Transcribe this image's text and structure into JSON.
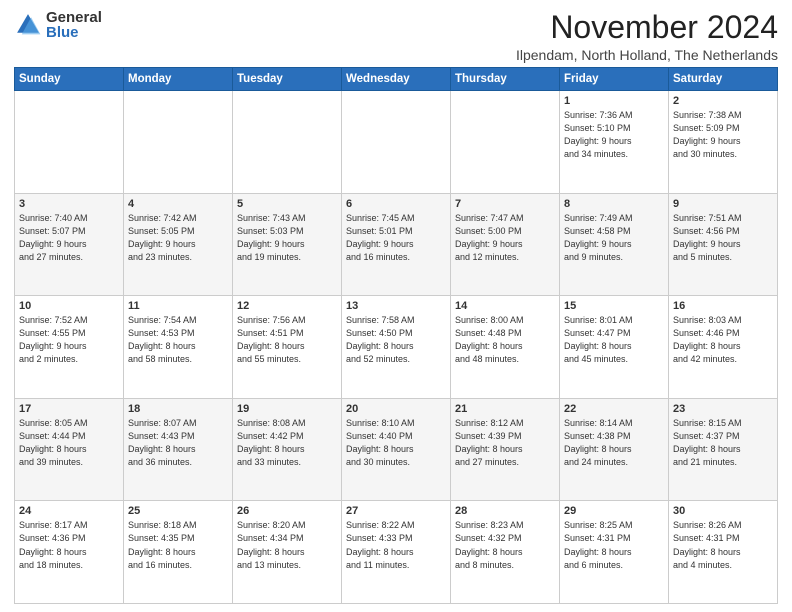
{
  "logo": {
    "general": "General",
    "blue": "Blue"
  },
  "title": "November 2024",
  "location": "Ilpendam, North Holland, The Netherlands",
  "headers": [
    "Sunday",
    "Monday",
    "Tuesday",
    "Wednesday",
    "Thursday",
    "Friday",
    "Saturday"
  ],
  "weeks": [
    [
      {
        "day": "",
        "info": ""
      },
      {
        "day": "",
        "info": ""
      },
      {
        "day": "",
        "info": ""
      },
      {
        "day": "",
        "info": ""
      },
      {
        "day": "",
        "info": ""
      },
      {
        "day": "1",
        "info": "Sunrise: 7:36 AM\nSunset: 5:10 PM\nDaylight: 9 hours\nand 34 minutes."
      },
      {
        "day": "2",
        "info": "Sunrise: 7:38 AM\nSunset: 5:09 PM\nDaylight: 9 hours\nand 30 minutes."
      }
    ],
    [
      {
        "day": "3",
        "info": "Sunrise: 7:40 AM\nSunset: 5:07 PM\nDaylight: 9 hours\nand 27 minutes."
      },
      {
        "day": "4",
        "info": "Sunrise: 7:42 AM\nSunset: 5:05 PM\nDaylight: 9 hours\nand 23 minutes."
      },
      {
        "day": "5",
        "info": "Sunrise: 7:43 AM\nSunset: 5:03 PM\nDaylight: 9 hours\nand 19 minutes."
      },
      {
        "day": "6",
        "info": "Sunrise: 7:45 AM\nSunset: 5:01 PM\nDaylight: 9 hours\nand 16 minutes."
      },
      {
        "day": "7",
        "info": "Sunrise: 7:47 AM\nSunset: 5:00 PM\nDaylight: 9 hours\nand 12 minutes."
      },
      {
        "day": "8",
        "info": "Sunrise: 7:49 AM\nSunset: 4:58 PM\nDaylight: 9 hours\nand 9 minutes."
      },
      {
        "day": "9",
        "info": "Sunrise: 7:51 AM\nSunset: 4:56 PM\nDaylight: 9 hours\nand 5 minutes."
      }
    ],
    [
      {
        "day": "10",
        "info": "Sunrise: 7:52 AM\nSunset: 4:55 PM\nDaylight: 9 hours\nand 2 minutes."
      },
      {
        "day": "11",
        "info": "Sunrise: 7:54 AM\nSunset: 4:53 PM\nDaylight: 8 hours\nand 58 minutes."
      },
      {
        "day": "12",
        "info": "Sunrise: 7:56 AM\nSunset: 4:51 PM\nDaylight: 8 hours\nand 55 minutes."
      },
      {
        "day": "13",
        "info": "Sunrise: 7:58 AM\nSunset: 4:50 PM\nDaylight: 8 hours\nand 52 minutes."
      },
      {
        "day": "14",
        "info": "Sunrise: 8:00 AM\nSunset: 4:48 PM\nDaylight: 8 hours\nand 48 minutes."
      },
      {
        "day": "15",
        "info": "Sunrise: 8:01 AM\nSunset: 4:47 PM\nDaylight: 8 hours\nand 45 minutes."
      },
      {
        "day": "16",
        "info": "Sunrise: 8:03 AM\nSunset: 4:46 PM\nDaylight: 8 hours\nand 42 minutes."
      }
    ],
    [
      {
        "day": "17",
        "info": "Sunrise: 8:05 AM\nSunset: 4:44 PM\nDaylight: 8 hours\nand 39 minutes."
      },
      {
        "day": "18",
        "info": "Sunrise: 8:07 AM\nSunset: 4:43 PM\nDaylight: 8 hours\nand 36 minutes."
      },
      {
        "day": "19",
        "info": "Sunrise: 8:08 AM\nSunset: 4:42 PM\nDaylight: 8 hours\nand 33 minutes."
      },
      {
        "day": "20",
        "info": "Sunrise: 8:10 AM\nSunset: 4:40 PM\nDaylight: 8 hours\nand 30 minutes."
      },
      {
        "day": "21",
        "info": "Sunrise: 8:12 AM\nSunset: 4:39 PM\nDaylight: 8 hours\nand 27 minutes."
      },
      {
        "day": "22",
        "info": "Sunrise: 8:14 AM\nSunset: 4:38 PM\nDaylight: 8 hours\nand 24 minutes."
      },
      {
        "day": "23",
        "info": "Sunrise: 8:15 AM\nSunset: 4:37 PM\nDaylight: 8 hours\nand 21 minutes."
      }
    ],
    [
      {
        "day": "24",
        "info": "Sunrise: 8:17 AM\nSunset: 4:36 PM\nDaylight: 8 hours\nand 18 minutes."
      },
      {
        "day": "25",
        "info": "Sunrise: 8:18 AM\nSunset: 4:35 PM\nDaylight: 8 hours\nand 16 minutes."
      },
      {
        "day": "26",
        "info": "Sunrise: 8:20 AM\nSunset: 4:34 PM\nDaylight: 8 hours\nand 13 minutes."
      },
      {
        "day": "27",
        "info": "Sunrise: 8:22 AM\nSunset: 4:33 PM\nDaylight: 8 hours\nand 11 minutes."
      },
      {
        "day": "28",
        "info": "Sunrise: 8:23 AM\nSunset: 4:32 PM\nDaylight: 8 hours\nand 8 minutes."
      },
      {
        "day": "29",
        "info": "Sunrise: 8:25 AM\nSunset: 4:31 PM\nDaylight: 8 hours\nand 6 minutes."
      },
      {
        "day": "30",
        "info": "Sunrise: 8:26 AM\nSunset: 4:31 PM\nDaylight: 8 hours\nand 4 minutes."
      }
    ]
  ]
}
